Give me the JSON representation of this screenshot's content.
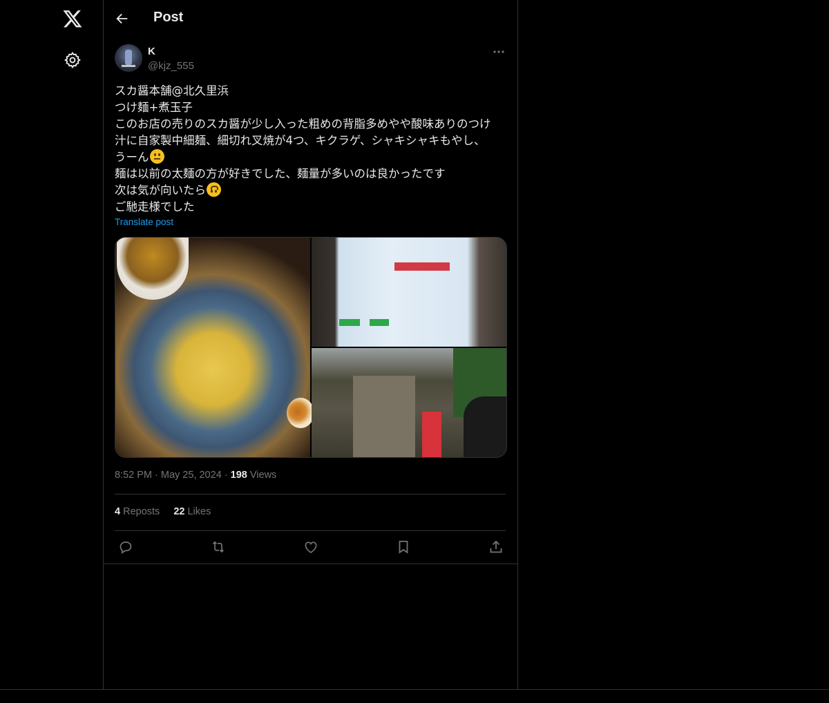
{
  "header": {
    "title": "Post"
  },
  "post": {
    "author_name": "K",
    "author_handle": "@kjz_555",
    "text_lines": [
      "スカ醤本舗@北久里浜",
      "つけ麺+煮玉子",
      "このお店の売りのスカ醤が少し入った粗めの背脂多めやや酸味ありのつけ",
      "汁に自家製中細麺、細切れ叉焼が4つ、キクラゲ、シャキシャキもやし、",
      "うーん",
      "麺は以前の太麺の方が好きでした、麺量が多いのは良かったです",
      "次は気が向いたら",
      "ご馳走様でした"
    ],
    "emojis": [
      "neutral-face",
      "upside-down-face"
    ],
    "translate_label": "Translate post",
    "time": "8:52 PM",
    "date": "May 25, 2024",
    "views_count": "198",
    "views_label": "Views",
    "reposts_count": "4",
    "reposts_label": "Reposts",
    "likes_count": "22",
    "likes_label": "Likes"
  },
  "icons": [
    "x-logo-icon",
    "settings-gear-icon",
    "back-arrow-icon",
    "more-options-icon",
    "reply-icon",
    "repost-icon",
    "like-icon",
    "bookmark-icon",
    "share-icon"
  ],
  "colors": {
    "background": "#000000",
    "text": "#e7e9ea",
    "secondary_text": "#71767b",
    "link": "#1d9bf0",
    "border": "#2f3336"
  }
}
